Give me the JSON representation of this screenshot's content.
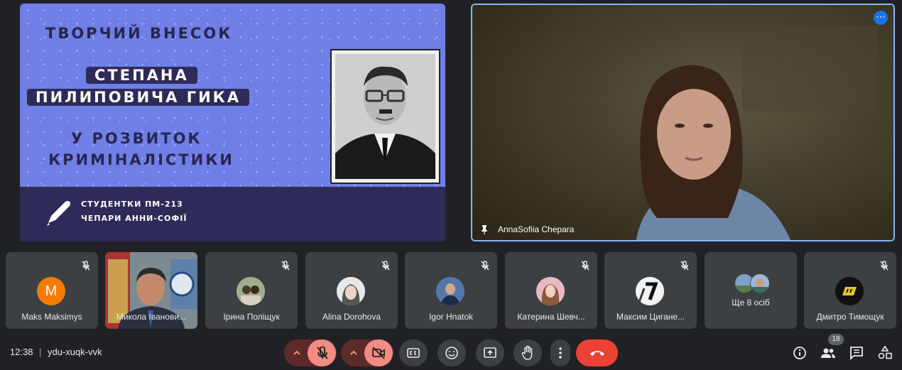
{
  "slide": {
    "line1": "ТВОРЧИЙ ВНЕСОК",
    "line2": "СТЕПАНА",
    "line3": "ПИЛИПОВИЧА ГИКА",
    "line4": "У РОЗВИТОК",
    "line5": "КРИМІНАЛІСТИКИ",
    "author1": "СТУДЕНТКИ ПМ-213",
    "author2": "ЧЕПАРИ АННИ-СОФІЇ"
  },
  "speaker": {
    "name": "AnnaSofiia Chepara",
    "menu": "⋯"
  },
  "tiles": [
    {
      "name": "Maks Maksimys",
      "initial": "M",
      "avatar_color": "#f57c00"
    },
    {
      "name": "Микола Іванови..."
    },
    {
      "name": "Ірина Поліщук"
    },
    {
      "name": "Alina Dorohova"
    },
    {
      "name": "Igor Hnatok"
    },
    {
      "name": "Катерина Шевч..."
    },
    {
      "name": "Максим Цигане..."
    },
    {
      "name": "Ще 8 осіб"
    },
    {
      "name": "Дмитро Тимощук"
    }
  ],
  "footer": {
    "time": "12:38",
    "separator": "|",
    "meeting_code": "ydu-xuqk-vvk",
    "participants_count": "18"
  },
  "colors": {
    "background": "#202124",
    "tile": "#3c4043",
    "end_call": "#ea4335",
    "muted_red": "#f28b82",
    "accent": "#8ab4f8"
  }
}
